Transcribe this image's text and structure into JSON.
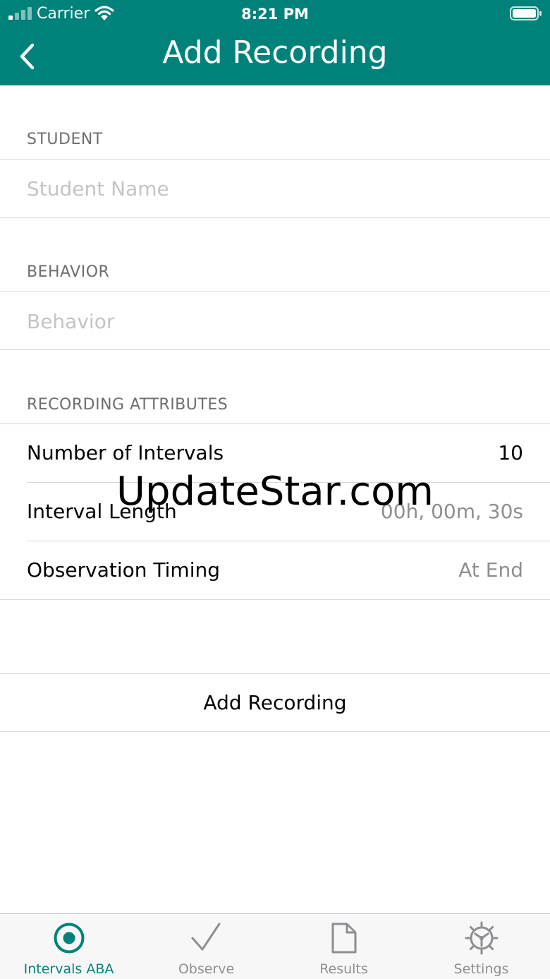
{
  "status_bar": {
    "carrier": "Carrier",
    "time": "8:21 PM"
  },
  "nav": {
    "title": "Add Recording"
  },
  "student": {
    "section_label": "STUDENT",
    "placeholder": "Student Name",
    "value": ""
  },
  "behavior": {
    "section_label": "BEHAVIOR",
    "placeholder": "Behavior",
    "value": ""
  },
  "attributes": {
    "section_label": "RECORDING ATTRIBUTES",
    "rows": [
      {
        "label": "Number of Intervals",
        "value": "10"
      },
      {
        "label": "Interval Length",
        "value": "00h, 00m, 30s"
      },
      {
        "label": "Observation Timing",
        "value": "At End"
      }
    ]
  },
  "add_button_label": "Add Recording",
  "watermark": "UpdateStar.com",
  "tabs": [
    {
      "label": "Intervals ABA",
      "icon": "record-icon",
      "active": true
    },
    {
      "label": "Observe",
      "icon": "checkmark-icon",
      "active": false
    },
    {
      "label": "Results",
      "icon": "document-icon",
      "active": false
    },
    {
      "label": "Settings",
      "icon": "gear-icon",
      "active": false
    }
  ],
  "colors": {
    "accent": "#00827b",
    "inactive": "#8e8e93",
    "section_text": "#6d6d72"
  }
}
